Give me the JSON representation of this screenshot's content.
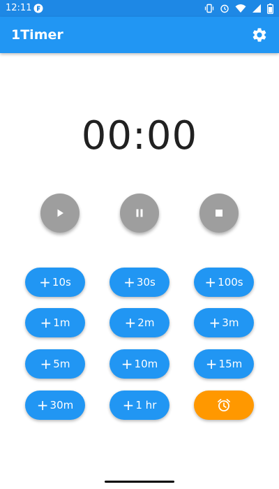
{
  "status_bar": {
    "time": "12:11",
    "icons": [
      "vibrate-icon",
      "alarm-icon",
      "wifi-icon",
      "signal-icon",
      "battery-icon"
    ]
  },
  "app_bar": {
    "title": "1Timer",
    "settings_icon": "gear-icon"
  },
  "timer": {
    "display": "00:00"
  },
  "controls": {
    "play_icon": "play-icon",
    "pause_icon": "pause-icon",
    "stop_icon": "stop-icon"
  },
  "increments": [
    {
      "label": "10s"
    },
    {
      "label": "30s"
    },
    {
      "label": "100s"
    },
    {
      "label": "1m"
    },
    {
      "label": "2m"
    },
    {
      "label": "3m"
    },
    {
      "label": "5m"
    },
    {
      "label": "10m"
    },
    {
      "label": "15m"
    },
    {
      "label": "30m"
    },
    {
      "label": "1 hr"
    }
  ],
  "plus_sign": "+",
  "alarm_button_icon": "alarm-clock-icon",
  "colors": {
    "primary": "#2196f3",
    "status_bar": "#1e88e5",
    "control_gray": "#9e9e9e",
    "alarm_orange": "#ff9800"
  }
}
